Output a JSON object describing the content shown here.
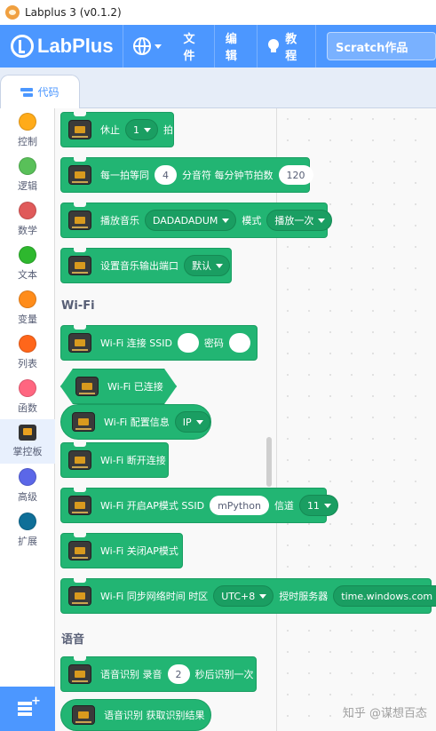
{
  "window": {
    "title": "Labplus 3 (v0.1.2)"
  },
  "menubar": {
    "logo_text": "LabPlus",
    "file": "文件",
    "edit": "编辑",
    "tutorial": "教程",
    "project_title": "Scratch作品",
    "accent_color": "#4c97ff"
  },
  "tabs": {
    "code": "代码"
  },
  "categories": [
    {
      "label": "控制",
      "color": "#ffab19"
    },
    {
      "label": "逻辑",
      "color": "#59c059"
    },
    {
      "label": "数学",
      "color": "#e05a5a"
    },
    {
      "label": "文本",
      "color": "#2eb82e"
    },
    {
      "label": "变量",
      "color": "#ff8c1a"
    },
    {
      "label": "列表",
      "color": "#ff661a"
    },
    {
      "label": "函数",
      "color": "#ff6680"
    },
    {
      "label": "掌控板",
      "icon": "board-icon",
      "active": true
    },
    {
      "label": "高级",
      "color": "#5b67e8"
    },
    {
      "label": "扩展",
      "color": "#0f6f98"
    }
  ],
  "blocks": {
    "rest": {
      "label": "休止",
      "value": "1",
      "unit": "拍"
    },
    "tempo": {
      "label": "每一拍等同",
      "value": "4",
      "mid": "分音符 每分钟节拍数",
      "bpm": "120"
    },
    "play_music": {
      "label": "播放音乐",
      "song": "DADADADUM",
      "mode_label": "模式",
      "mode": "播放一次"
    },
    "set_music_pin": {
      "label": "设置音乐输出端口",
      "value": "默认"
    },
    "wifi_section": "Wi-Fi",
    "wifi_connect": {
      "label": "Wi-Fi 连接 SSID",
      "password_label": "密码"
    },
    "wifi_connected": {
      "label": "Wi-Fi 已连接"
    },
    "wifi_config": {
      "label": "Wi-Fi 配置信息",
      "value": "IP"
    },
    "wifi_disconnect": {
      "label": "Wi-Fi 断开连接"
    },
    "wifi_ap_on": {
      "label": "Wi-Fi 开启AP模式 SSID",
      "ssid": "mPython",
      "channel_label": "信道",
      "channel": "11"
    },
    "wifi_ap_off": {
      "label": "Wi-Fi 关闭AP模式"
    },
    "wifi_ntp": {
      "label": "Wi-Fi 同步网络时间 时区",
      "tz": "UTC+8",
      "server_label": "授时服务器",
      "server": "time.windows.com"
    },
    "voice_section": "语音",
    "voice_record": {
      "label": "语音识别 录音",
      "value": "2",
      "suffix": "秒后识别一次"
    },
    "voice_result": {
      "label": "语音识别 获取识别结果"
    }
  },
  "watermark": "知乎 @谋想百态",
  "block_color": "#22b573"
}
